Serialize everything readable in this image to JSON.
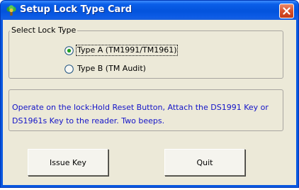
{
  "window": {
    "title": "Setup Lock Type Card"
  },
  "lock_type_group": {
    "label": "Select Lock Type",
    "options": [
      {
        "label": "Type A (TM1991/TM1961)",
        "selected": true
      },
      {
        "label": "Type B (TM Audit)",
        "selected": false
      }
    ]
  },
  "instructions": {
    "text": "Operate on the lock:Hold Reset Button, Attach the DS1991 Key or DS1961s Key to the reader. Two beeps."
  },
  "buttons": {
    "issue_key": "Issue Key",
    "quit": "Quit"
  },
  "colors": {
    "titlebar": "#0a58e0",
    "dialog_background": "#ece9d8",
    "instruction_text": "#1414c8",
    "close_button": "#d9512c"
  },
  "icons": {
    "app": "app-icon",
    "close": "close-icon"
  }
}
